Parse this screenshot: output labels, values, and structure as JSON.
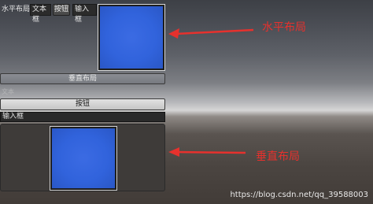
{
  "horizontal_row": {
    "label": "水平布局",
    "text_field": "文本框",
    "button": "按钮",
    "input": "输入框"
  },
  "vertical_layout": {
    "title_bar": "垂直布局",
    "faint_label": "文本",
    "button": "按钮",
    "input": "输入框"
  },
  "annotations": {
    "horizontal": "水平布局",
    "vertical": "垂直布局"
  },
  "watermark": "https://blog.csdn.net/qq_39588003",
  "colors": {
    "annotation": "#e6312d",
    "image_blue": "#3163dc"
  }
}
